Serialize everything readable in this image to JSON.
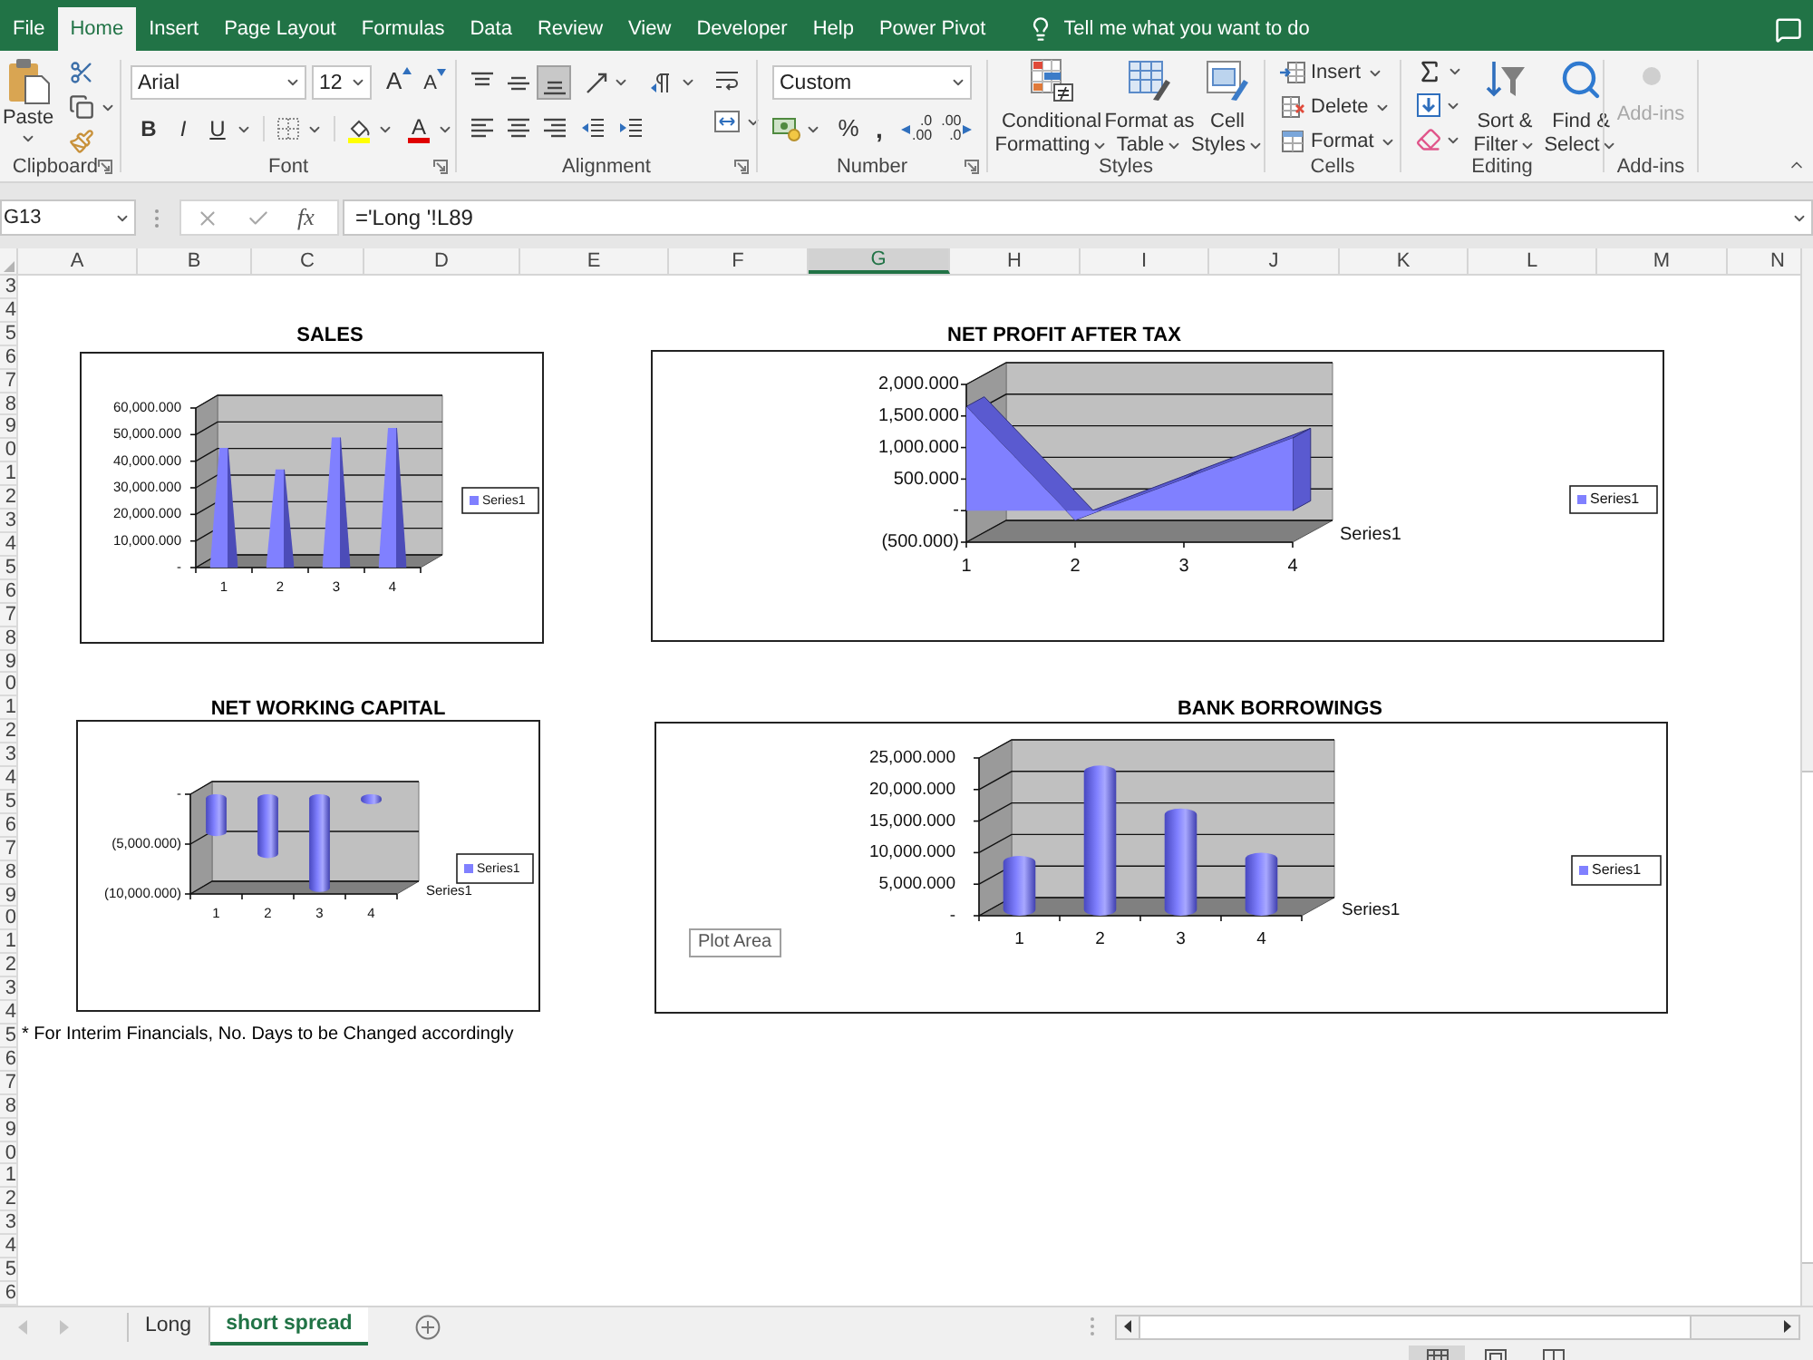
{
  "ribbon_tabs": [
    {
      "label": "File",
      "selected": false
    },
    {
      "label": "Home",
      "selected": true
    },
    {
      "label": "Insert",
      "selected": false
    },
    {
      "label": "Page Layout",
      "selected": false
    },
    {
      "label": "Formulas",
      "selected": false
    },
    {
      "label": "Data",
      "selected": false
    },
    {
      "label": "Review",
      "selected": false
    },
    {
      "label": "View",
      "selected": false
    },
    {
      "label": "Developer",
      "selected": false
    },
    {
      "label": "Help",
      "selected": false
    },
    {
      "label": "Power Pivot",
      "selected": false
    }
  ],
  "tell_me": {
    "placeholder": "Tell me what you want to do"
  },
  "ribbon": {
    "clipboard": {
      "label": "Clipboard",
      "paste": "Paste"
    },
    "font": {
      "label": "Font",
      "font_name": "Arial",
      "font_size": "12",
      "grow": "A",
      "shrink": "A",
      "styles": [
        {
          "kind": "bold",
          "glyph": "B",
          "on": false
        },
        {
          "kind": "italic",
          "glyph": "I",
          "on": false
        },
        {
          "kind": "underline",
          "glyph": "U",
          "on": false
        }
      ],
      "font_color": "A"
    },
    "alignment": {
      "label": "Alignment",
      "vertical": [
        {
          "kind": "top",
          "selected": false
        },
        {
          "kind": "middle",
          "selected": false
        },
        {
          "kind": "bottom",
          "selected": true
        }
      ],
      "horizontal": [
        {
          "kind": "left",
          "selected": false
        },
        {
          "kind": "center",
          "selected": false
        },
        {
          "kind": "right",
          "selected": false
        }
      ]
    },
    "number": {
      "label": "Number",
      "format": "Custom",
      "percent": "%",
      "comma": ",",
      "increase_decimal": [
        ".0",
        ".00"
      ],
      "decrease_decimal": [
        ".00",
        ".0"
      ]
    },
    "styles": {
      "label": "Styles",
      "buttons": [
        {
          "kind": "conditional",
          "lines": [
            "Conditional",
            "Formatting"
          ]
        },
        {
          "kind": "table",
          "lines": [
            "Format as",
            "Table"
          ]
        },
        {
          "kind": "cell",
          "lines": [
            "Cell",
            "Styles"
          ]
        }
      ]
    },
    "cells": {
      "label": "Cells",
      "buttons": [
        {
          "kind": "insert",
          "label": "Insert"
        },
        {
          "kind": "delete",
          "label": "Delete"
        },
        {
          "kind": "format",
          "label": "Format"
        }
      ]
    },
    "editing": {
      "label": "Editing",
      "buttons": [
        {
          "kind": "sort",
          "lines": [
            "Sort &",
            "Filter"
          ]
        },
        {
          "kind": "find",
          "lines": [
            "Find &",
            "Select"
          ]
        }
      ]
    },
    "addins": {
      "label": "Add-ins",
      "button": "Add-ins",
      "disabled": true
    }
  },
  "formula_bar": {
    "name_box": "G13",
    "buttons": [
      {
        "kind": "cancel",
        "disabled": true
      },
      {
        "kind": "enter",
        "disabled": true
      }
    ],
    "function_glyph": "fx",
    "formula": "='Long '!L89"
  },
  "columns": [
    {
      "label": "A",
      "selected": false
    },
    {
      "label": "B",
      "selected": false
    },
    {
      "label": "C",
      "selected": false
    },
    {
      "label": "D",
      "selected": false
    },
    {
      "label": "E",
      "selected": false
    },
    {
      "label": "F",
      "selected": false
    },
    {
      "label": "G",
      "selected": true
    },
    {
      "label": "H",
      "selected": false
    },
    {
      "label": "I",
      "selected": false
    },
    {
      "label": "J",
      "selected": false
    },
    {
      "label": "K",
      "selected": false
    },
    {
      "label": "L",
      "selected": false
    },
    {
      "label": "M",
      "selected": false
    },
    {
      "label": "N",
      "selected": false
    }
  ],
  "rows": [
    {
      "header": "3"
    },
    {
      "header": "4"
    },
    {
      "header": "5"
    },
    {
      "header": "6"
    },
    {
      "header": "7"
    },
    {
      "header": "8"
    },
    {
      "header": "9"
    },
    {
      "header": "0"
    },
    {
      "header": "1"
    },
    {
      "header": "2"
    },
    {
      "header": "3"
    },
    {
      "header": "4"
    },
    {
      "header": "5"
    },
    {
      "header": "6"
    },
    {
      "header": "7"
    },
    {
      "header": "8"
    },
    {
      "header": "9"
    },
    {
      "header": "0"
    },
    {
      "header": "1"
    },
    {
      "header": "2"
    },
    {
      "header": "3"
    },
    {
      "header": "4"
    },
    {
      "header": "5"
    },
    {
      "header": "6"
    },
    {
      "header": "7"
    },
    {
      "header": "8"
    },
    {
      "header": "9"
    },
    {
      "header": "0"
    },
    {
      "header": "1"
    },
    {
      "header": "2"
    },
    {
      "header": "3"
    },
    {
      "header": "4"
    },
    {
      "header": "5",
      "column_a": "* For Interim Financials, No. Days to be Changed accordingly"
    },
    {
      "header": "6"
    },
    {
      "header": "7"
    },
    {
      "header": "8"
    },
    {
      "header": "9"
    },
    {
      "header": "0"
    },
    {
      "header": "1"
    },
    {
      "header": "2"
    },
    {
      "header": "3"
    },
    {
      "header": "4"
    },
    {
      "header": "5"
    },
    {
      "header": "6"
    }
  ],
  "charts": [
    {
      "kind": "pyramid",
      "chart_data": {
        "type": "bar",
        "title": "SALES",
        "categories": [
          "1",
          "2",
          "3",
          "4"
        ],
        "series": [
          {
            "name": "Series1",
            "color": "#8080ff",
            "values": [
              45000,
              37000,
              49000,
              52500
            ]
          }
        ],
        "ylim": [
          0,
          60000
        ],
        "yticks": [
          {
            "value": 0,
            "label": "-"
          },
          {
            "value": 10000,
            "label": "10,000.000"
          },
          {
            "value": 20000,
            "label": "20,000.000"
          },
          {
            "value": 30000,
            "label": "30,000.000"
          },
          {
            "value": 40000,
            "label": "40,000.000"
          },
          {
            "value": 50000,
            "label": "50,000.000"
          },
          {
            "value": 60000,
            "label": "60,000.000"
          }
        ]
      }
    },
    {
      "kind": "area",
      "depth_axis_label": "Series1",
      "chart_data": {
        "type": "area",
        "title": "NET PROFIT AFTER TAX",
        "categories": [
          "1",
          "2",
          "3",
          "4"
        ],
        "series": [
          {
            "name": "Series1",
            "color": "#8080ff",
            "values": [
              1650,
              -150,
              500,
              1150
            ]
          }
        ],
        "ylim": [
          -500,
          2000
        ],
        "yticks": [
          {
            "value": -500,
            "label": "(500.000)"
          },
          {
            "value": 0,
            "label": "-"
          },
          {
            "value": 500,
            "label": "500.000"
          },
          {
            "value": 1000,
            "label": "1,000.000"
          },
          {
            "value": 1500,
            "label": "1,500.000"
          },
          {
            "value": 2000,
            "label": "2,000.000"
          }
        ]
      }
    },
    {
      "kind": "cylinder",
      "depth_axis_label": "Series1",
      "chart_data": {
        "type": "bar",
        "title": "NET WORKING CAPITAL",
        "categories": [
          "1",
          "2",
          "3",
          "4"
        ],
        "series": [
          {
            "name": "Series1",
            "color": "#8080ff",
            "values": [
              -4200,
              -6400,
              -9800,
              -1000
            ]
          }
        ],
        "ylim": [
          -10000,
          0
        ],
        "yticks": [
          {
            "value": -10000,
            "label": "(10,000.000)"
          },
          {
            "value": -5000,
            "label": "(5,000.000)"
          },
          {
            "value": 0,
            "label": "-"
          }
        ]
      }
    },
    {
      "kind": "cylinder",
      "depth_axis_label": "Series1",
      "tooltip": "Plot Area",
      "chart_data": {
        "type": "bar",
        "title": "BANK BORROWINGS",
        "categories": [
          "1",
          "2",
          "3",
          "4"
        ],
        "series": [
          {
            "name": "Series1",
            "color": "#8080ff",
            "values": [
              9500,
              23800,
              17000,
              10000
            ]
          }
        ],
        "ylim": [
          0,
          25000
        ],
        "yticks": [
          {
            "value": 0,
            "label": "-"
          },
          {
            "value": 5000,
            "label": "5,000.000"
          },
          {
            "value": 10000,
            "label": "10,000.000"
          },
          {
            "value": 15000,
            "label": "15,000.000"
          },
          {
            "value": 20000,
            "label": "20,000.000"
          },
          {
            "value": 25000,
            "label": "25,000.000"
          }
        ]
      }
    }
  ],
  "sheet_nav": [
    {
      "kind": "previous",
      "disabled": true
    },
    {
      "kind": "next",
      "disabled": true
    }
  ],
  "sheet_tabs": [
    {
      "label": "Long",
      "selected": false
    },
    {
      "label": "short spread",
      "selected": true
    }
  ],
  "view_buttons": [
    {
      "kind": "normal",
      "selected": true
    },
    {
      "kind": "page_layout",
      "selected": false
    },
    {
      "kind": "page_break",
      "selected": false
    }
  ]
}
